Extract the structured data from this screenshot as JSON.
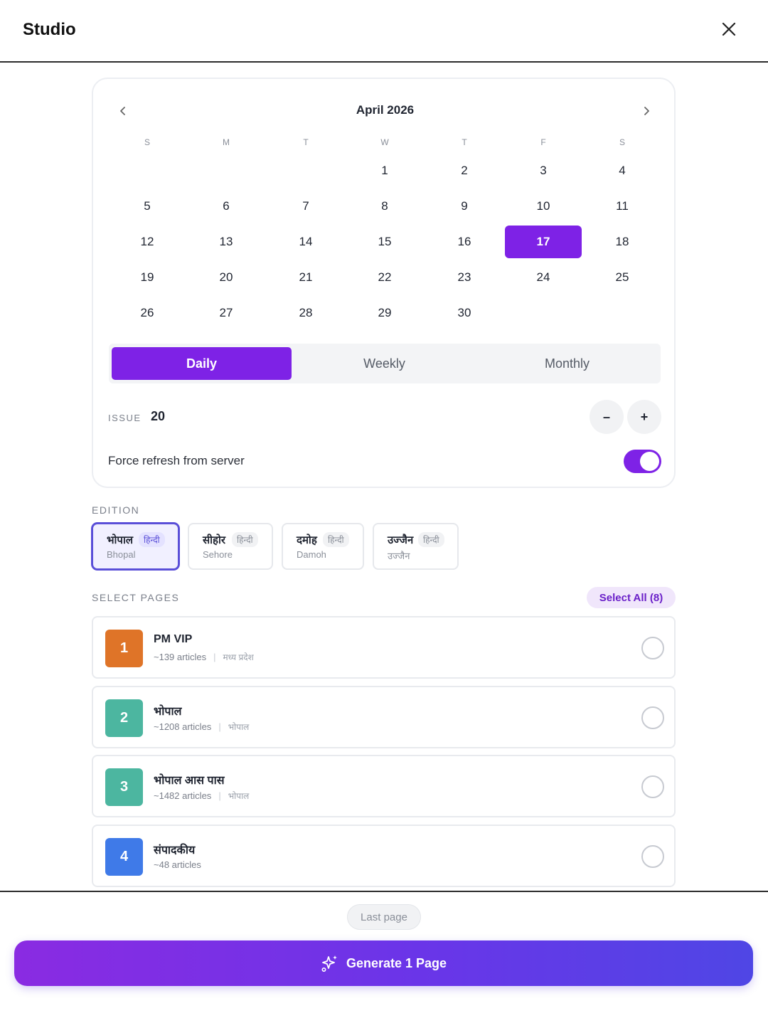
{
  "header": {
    "title": "Studio",
    "close_icon": "close-icon"
  },
  "calendar": {
    "month_label": "April 2026",
    "prev_icon": "chevron-left-icon",
    "next_icon": "chevron-right-icon",
    "weekdays": [
      "S",
      "M",
      "T",
      "W",
      "T",
      "F",
      "S"
    ],
    "weeks": [
      [
        "",
        "",
        "",
        "1",
        "2",
        "3",
        "4"
      ],
      [
        "5",
        "6",
        "7",
        "8",
        "9",
        "10",
        "11"
      ],
      [
        "12",
        "13",
        "14",
        "15",
        "16",
        "17",
        "18"
      ],
      [
        "19",
        "20",
        "21",
        "22",
        "23",
        "24",
        "25"
      ],
      [
        "26",
        "27",
        "28",
        "29",
        "30",
        "",
        ""
      ]
    ],
    "selected_day": "17",
    "accent_color": "#7e22e6"
  },
  "frequency": {
    "options": [
      "Daily",
      "Weekly",
      "Monthly"
    ],
    "selected": "Daily"
  },
  "issue": {
    "label": "ISSUE",
    "value": "20",
    "decrement_label": "–",
    "increment_label": "+"
  },
  "force_refresh": {
    "label": "Force refresh from server",
    "enabled": true
  },
  "edition": {
    "label": "EDITION",
    "items": [
      {
        "name": "भोपाल",
        "tag": "हिन्दी",
        "sub": "Bhopal",
        "selected": true
      },
      {
        "name": "सीहोर",
        "tag": "हिन्दी",
        "sub": "Sehore",
        "selected": false
      },
      {
        "name": "दमोह",
        "tag": "हिन्दी",
        "sub": "Damoh",
        "selected": false
      },
      {
        "name": "उज्जैन",
        "tag": "हिन्दी",
        "sub": "उज्जैन",
        "selected": false
      }
    ]
  },
  "pages": {
    "label": "SELECT PAGES",
    "select_all_label": "Select All (8)",
    "items": [
      {
        "number": "1",
        "title": "PM VIP",
        "articles": "~139 articles",
        "region": "मध्य प्रदेश",
        "color": "#df7428",
        "selected": false
      },
      {
        "number": "2",
        "title": "भोपाल",
        "articles": "~1208 articles",
        "region": "भोपाल",
        "color": "#4cb6a0",
        "selected": false
      },
      {
        "number": "3",
        "title": "भोपाल आस पास",
        "articles": "~1482 articles",
        "region": "भोपाल",
        "color": "#4cb6a0",
        "selected": false
      },
      {
        "number": "4",
        "title": "संपादकीय",
        "articles": "~48 articles",
        "region": "",
        "color": "#3f7ae8",
        "selected": false
      }
    ]
  },
  "footer": {
    "last_page_label": "Last page",
    "generate_label": "Generate 1 Page",
    "generate_icon": "sparkles-icon"
  }
}
